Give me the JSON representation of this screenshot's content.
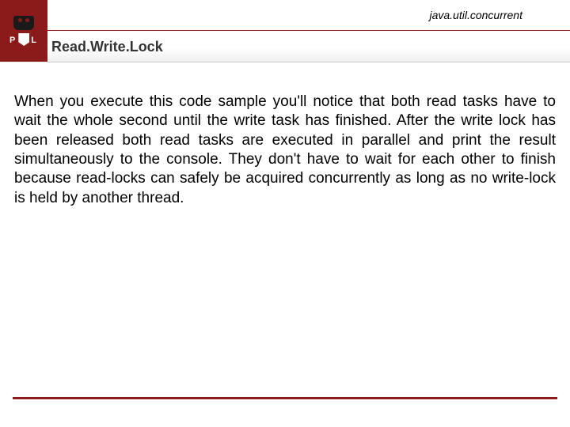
{
  "header": {
    "breadcrumb": "java.util.concurrent",
    "title": "Read.Write.Lock",
    "logo_letters": "P   L"
  },
  "content": {
    "paragraph": "When you execute this code sample you'll notice that both read tasks have to wait the whole second until the write task has finished. After the write lock has been released both read tasks are executed in parallel and print the result simultaneously to the console. They don't have to wait for each other to finish because read-locks can safely be acquired concurrently as long as no write-lock is held by another thread."
  }
}
